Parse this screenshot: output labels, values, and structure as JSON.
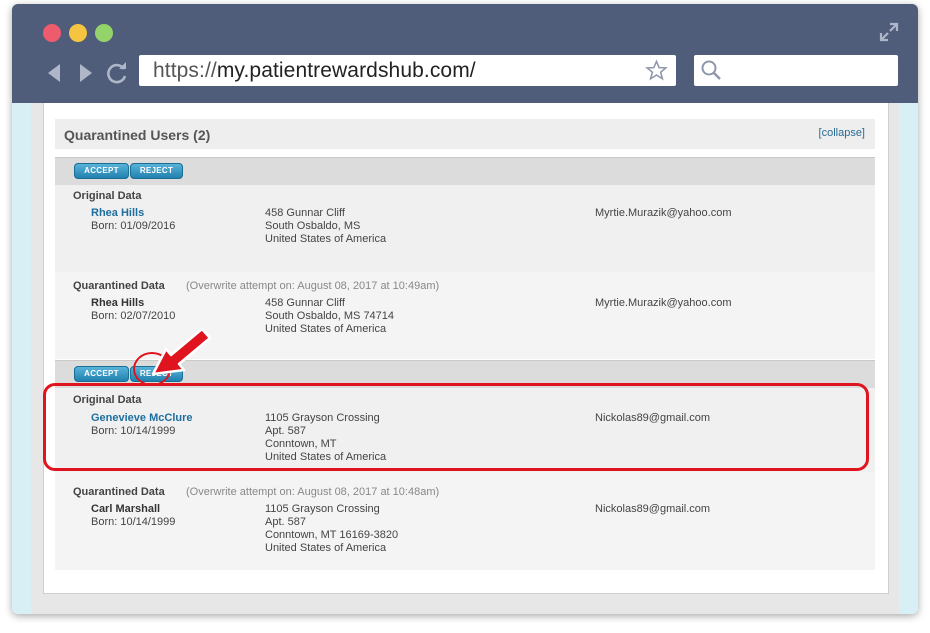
{
  "browser": {
    "url_protocol": "https://",
    "url_host": "my.patientrewardshub.com/",
    "search_placeholder": ""
  },
  "panel": {
    "title": "Quarantined Users (2)",
    "collapse_label": "[collapse]"
  },
  "buttons": {
    "accept": "ACCEPT",
    "reject": "REJECT"
  },
  "users": [
    {
      "original_label": "Original Data",
      "original": {
        "name": "Rhea Hills",
        "born": "Born: 01/09/2016",
        "address": [
          "458 Gunnar Cliff",
          "South Osbaldo, MS",
          "United States of America"
        ],
        "email": "Myrtie.Murazik@yahoo.com"
      },
      "quarantined_label": "Quarantined Data",
      "overwrite": "(Overwrite attempt on: August 08, 2017 at 10:49am)",
      "quarantined": {
        "name": "Rhea Hills",
        "born": "Born: 02/07/2010",
        "address": [
          "458 Gunnar Cliff",
          "South Osbaldo, MS 74714",
          "United States of America"
        ],
        "email": "Myrtie.Murazik@yahoo.com"
      }
    },
    {
      "original_label": "Original Data",
      "original": {
        "name": "Genevieve McClure",
        "born": "Born: 10/14/1999",
        "address": [
          "1105 Grayson Crossing",
          "Apt. 587",
          "Conntown, MT",
          "United States of America"
        ],
        "email": "Nickolas89@gmail.com"
      },
      "quarantined_label": "Quarantined Data",
      "overwrite": "(Overwrite attempt on: August 08, 2017 at 10:48am)",
      "quarantined": {
        "name": "Carl Marshall",
        "born": "Born: 10/14/1999",
        "address": [
          "1105 Grayson Crossing",
          "Apt. 587",
          "Conntown, MT 16169-3820",
          "United States of America"
        ],
        "email": "Nickolas89@gmail.com"
      }
    }
  ],
  "colors": {
    "titlebar": "#4f5d7b",
    "accent_button": "#2181ae",
    "annotation": "#e0141e",
    "link": "#1e6f9f"
  }
}
